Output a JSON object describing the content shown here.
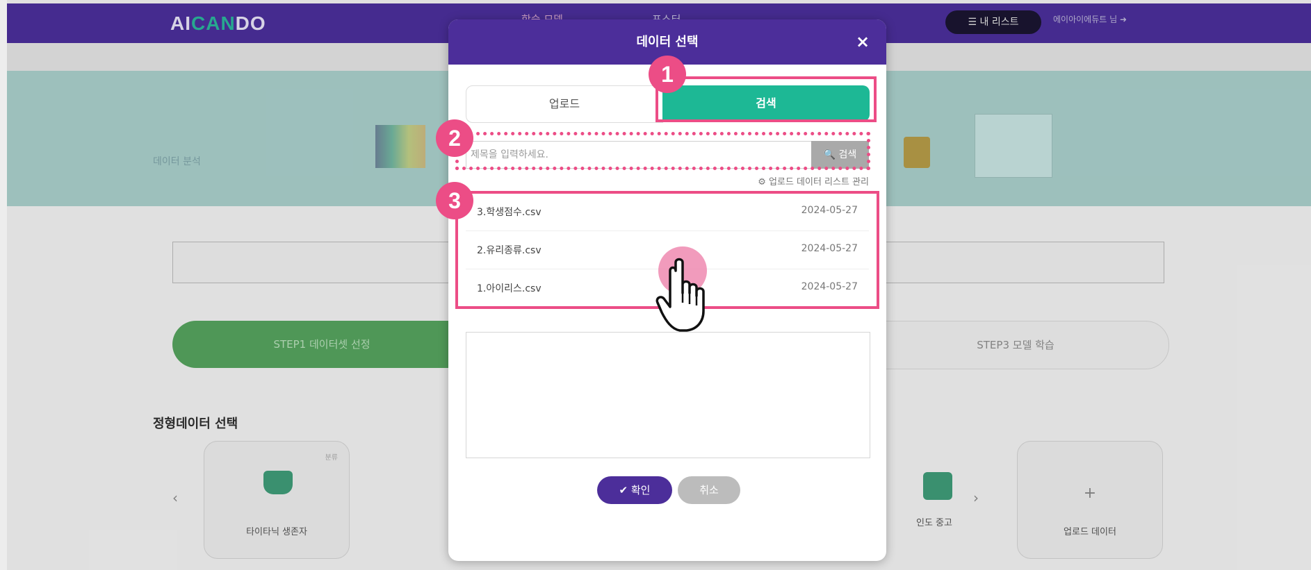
{
  "background": {
    "logo_prefix": "AI",
    "logo_accent": "CAN",
    "logo_suffix": "DO",
    "nav_items": [
      "학습 모델",
      "포스터"
    ],
    "my_list_label": "☰ 내 리스트",
    "user_label": "에이아이에듀트 님 ➜",
    "hero_title": "데이터 분석",
    "step1_label": "STEP1 데이터셋 선정",
    "step3_label": "STEP3 모델 학습",
    "section_title": "정형데이터 선택",
    "cards": [
      {
        "label": "타이타닉 생존자",
        "tag": "분류"
      },
      {
        "label": "업로드 데이터",
        "plus": "+"
      }
    ],
    "car_label": "인도 중고",
    "arrow_left": "‹",
    "arrow_right": "›"
  },
  "modal": {
    "title": "데이터 선택",
    "close": "×",
    "tabs": [
      {
        "label": "업로드",
        "active": false
      },
      {
        "label": "검색",
        "active": true
      }
    ],
    "search": {
      "placeholder": "제목을 입력하세요.",
      "button": "🔍 검색"
    },
    "manage_link": "⚙ 업로드 데이터 리스트 관리",
    "files": [
      {
        "name": "3.학생점수.csv",
        "date": "2024-05-27"
      },
      {
        "name": "2.유리종류.csv",
        "date": "2024-05-27"
      },
      {
        "name": "1.아이리스.csv",
        "date": "2024-05-27"
      }
    ],
    "confirm_label": "✔ 확인",
    "cancel_label": "취소"
  },
  "annotations": {
    "badges": [
      "1",
      "2",
      "3"
    ],
    "highlight_color": "#ec4d86",
    "pointer_icon": "hand-pointer-icon"
  },
  "colors": {
    "brand_purple": "#4c2e9a",
    "tab_active_green": "#1db895",
    "step_green": "#56a35e"
  }
}
